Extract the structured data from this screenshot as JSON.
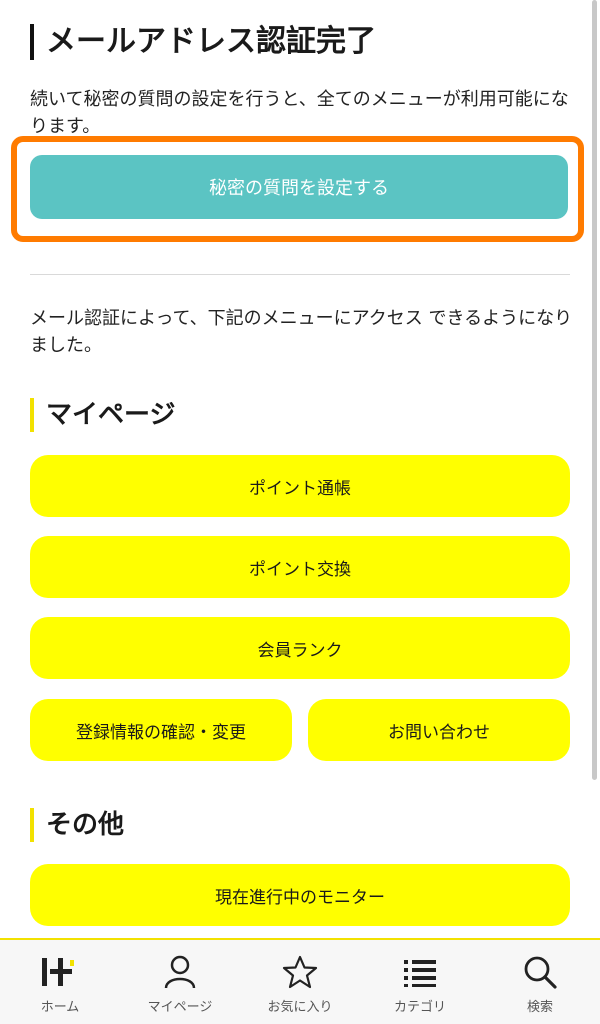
{
  "header": {
    "title": "メールアドレス認証完了"
  },
  "intro": {
    "text": "続いて秘密の質問の設定を行うと、全てのメニューが利用可能になります。"
  },
  "setup": {
    "button_label": "秘密の質問を設定する"
  },
  "access": {
    "text": "メール認証によって、下記のメニューにアクセス できるようになりました。"
  },
  "mypage_section": {
    "heading": "マイページ",
    "buttons": [
      "ポイント通帳",
      "ポイント交換",
      "会員ランク",
      "登録情報の確認・変更",
      "お問い合わせ"
    ]
  },
  "other_section": {
    "heading": "その他",
    "buttons": [
      "現在進行中のモニター"
    ]
  },
  "tabbar": {
    "tabs": [
      {
        "label": "ホーム",
        "icon": "home-logo-icon"
      },
      {
        "label": "マイページ",
        "icon": "person-icon"
      },
      {
        "label": "お気に入り",
        "icon": "star-icon"
      },
      {
        "label": "カテゴリ",
        "icon": "list-icon"
      },
      {
        "label": "検索",
        "icon": "search-icon"
      }
    ]
  },
  "colors": {
    "accent_teal": "#5bc4c3",
    "highlight_orange": "#ff7b00",
    "button_yellow": "#ffff00",
    "heading_bar_yellow": "#f2e100"
  }
}
